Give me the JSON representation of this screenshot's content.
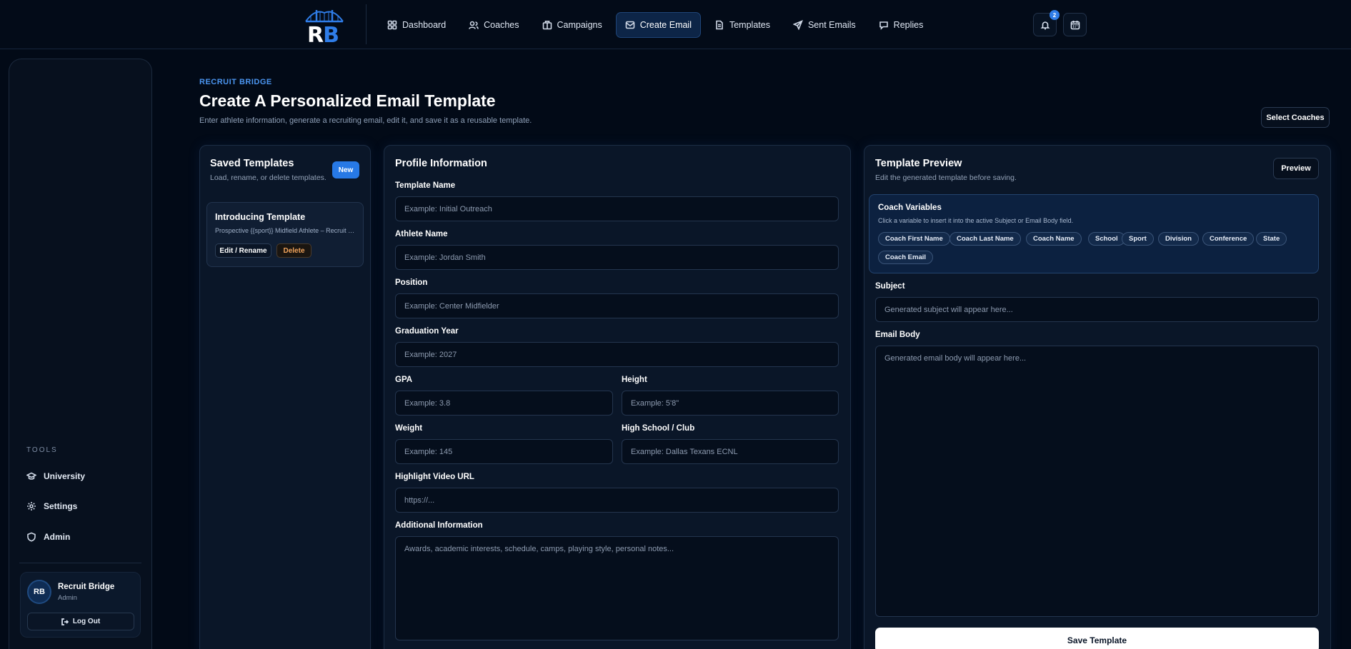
{
  "app": {
    "logo_text_r": "R",
    "logo_text_b": "B"
  },
  "nav": {
    "items": [
      {
        "label": "Dashboard",
        "icon": "dashboard-icon"
      },
      {
        "label": "Coaches",
        "icon": "users-icon"
      },
      {
        "label": "Campaigns",
        "icon": "building-icon"
      },
      {
        "label": "Create Email",
        "icon": "mail-icon",
        "active": true
      },
      {
        "label": "Templates",
        "icon": "document-icon"
      },
      {
        "label": "Sent Emails",
        "icon": "send-icon"
      },
      {
        "label": "Replies",
        "icon": "chat-icon"
      }
    ],
    "notification_count": "2"
  },
  "sidebar": {
    "tools_title": "TOOLS",
    "items": [
      {
        "label": "University",
        "icon": "graduation-cap-icon"
      },
      {
        "label": "Settings",
        "icon": "gear-icon"
      },
      {
        "label": "Admin",
        "icon": "shield-icon"
      }
    ],
    "user": {
      "initials": "RB",
      "name": "Recruit Bridge",
      "role": "Admin",
      "logout_label": "Log Out"
    }
  },
  "header": {
    "eyebrow": "RECRUIT BRIDGE",
    "title": "Create A Personalized Email Template",
    "subtitle": "Enter athlete information, generate a recruiting email, edit it, and save it as a reusable template.",
    "select_coaches_label": "Select Coaches"
  },
  "saved_templates": {
    "title": "Saved Templates",
    "subtitle": "Load, rename, or delete templates.",
    "new_label": "New",
    "items": [
      {
        "name": "Introducing Template",
        "subject": "Prospective {{sport}} Midfield Athlete – Recruit Bridge",
        "edit_label": "Edit / Rename",
        "delete_label": "Delete"
      }
    ]
  },
  "profile": {
    "title": "Profile Information",
    "fields": {
      "template_name": {
        "label": "Template Name",
        "placeholder": "Example: Initial Outreach"
      },
      "athlete_name": {
        "label": "Athlete Name",
        "placeholder": "Example: Jordan Smith"
      },
      "position": {
        "label": "Position",
        "placeholder": "Example: Center Midfielder"
      },
      "graduation_year": {
        "label": "Graduation Year",
        "placeholder": "Example: 2027"
      },
      "gpa": {
        "label": "GPA",
        "placeholder": "Example: 3.8"
      },
      "height": {
        "label": "Height",
        "placeholder": "Example: 5'8\""
      },
      "weight": {
        "label": "Weight",
        "placeholder": "Example: 145"
      },
      "high_school": {
        "label": "High School / Club",
        "placeholder": "Example: Dallas Texans ECNL"
      },
      "highlight_video": {
        "label": "Highlight Video URL",
        "placeholder": "https://..."
      },
      "additional_info": {
        "label": "Additional Information",
        "placeholder": "Awards, academic interests, schedule, camps, playing style, personal notes..."
      }
    }
  },
  "preview": {
    "title": "Template Preview",
    "subtitle": "Edit the generated template before saving.",
    "preview_label": "Preview",
    "variables": {
      "title": "Coach Variables",
      "subtitle": "Click a variable to insert it into the active Subject or Email Body field.",
      "chips": [
        "Coach First Name",
        "Coach Last Name",
        "Coach Name",
        "School",
        "Sport",
        "Division",
        "Conference",
        "State",
        "Coach Email"
      ]
    },
    "subject": {
      "label": "Subject",
      "placeholder": "Generated subject will appear here..."
    },
    "body": {
      "label": "Email Body",
      "placeholder": "Generated email body will appear here..."
    },
    "save_label": "Save Template"
  },
  "colors": {
    "background": "#020a17",
    "panel": "#0a1628",
    "accent": "#2f7de8",
    "danger": "#f0a35c"
  }
}
